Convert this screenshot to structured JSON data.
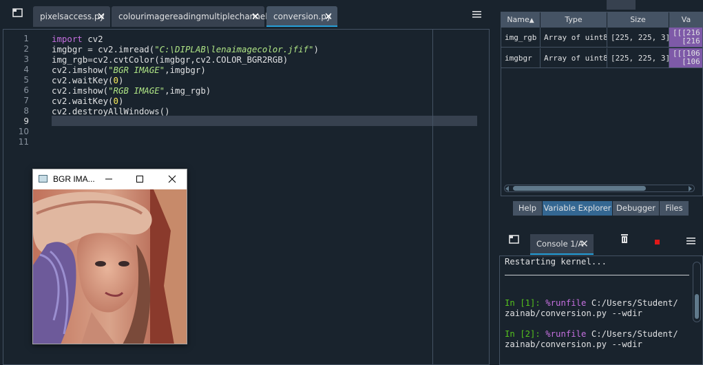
{
  "editor": {
    "tabs": [
      {
        "label": "pixelsaccess.py"
      },
      {
        "label": "colourimagereadingmultiplechannels.py"
      },
      {
        "label": "conversion.py"
      }
    ],
    "close_glyph": "✕",
    "line_numbers": [
      "1",
      "2",
      "3",
      "4",
      "5",
      "6",
      "7",
      "8",
      "9",
      "10",
      "11"
    ],
    "current_line": "9",
    "code": {
      "l1_kw": "import",
      "l1_rest": " cv2",
      "l2_a": "imgbgr = cv2.imread(",
      "l2_str": "\"C:\\DIPLAB\\lenaimagecolor.jfif\"",
      "l2_b": ")",
      "l3": "img_rgb=cv2.cvtColor(imgbgr,cv2.COLOR_BGR2RGB)",
      "l4_a": "cv2.imshow(",
      "l4_str": "\"BGR IMAGE\"",
      "l4_b": ",imgbgr)",
      "l5_a": "cv2.waitKey(",
      "l5_num": "0",
      "l5_b": ")",
      "l6_a": "cv2.imshow(",
      "l6_str": "\"RGB IMAGE\"",
      "l6_b": ",img_rgb)",
      "l7_a": "cv2.waitKey(",
      "l7_num": "0",
      "l7_b": ")",
      "l8": "cv2.destroyAllWindows()"
    }
  },
  "bgr_window": {
    "title": "BGR IMA...",
    "minimize_glyph": "—",
    "maximize_glyph": "☐",
    "close_glyph": "✕"
  },
  "variable_explorer": {
    "columns": [
      "Name",
      "Type",
      "Size",
      "Va"
    ],
    "sort_glyph": "▲",
    "rows": [
      {
        "name": "img_rgb",
        "type": "Array of uint8",
        "size": "[225, 225, 3]",
        "value_l1": "[[[216",
        "value_l2": "  [216"
      },
      {
        "name": "imgbgr",
        "type": "Array of uint8",
        "size": "[225, 225, 3]",
        "value_l1": "[[[106",
        "value_l2": "  [106"
      }
    ],
    "value_color": "#7e5aa8"
  },
  "pane_tabs": [
    {
      "label": "Help"
    },
    {
      "label": "Variable Explorer"
    },
    {
      "label": "Debugger"
    },
    {
      "label": "Files"
    }
  ],
  "console": {
    "tab_label": "Console 1/A",
    "close_glyph": "✕",
    "restart": "Restarting kernel...",
    "in1_prompt": "In [1]:",
    "in1_magic": "%runfile",
    "in1_path1": " C:/Users/Student/",
    "in1_path2": "zainab/conversion.py --wdir",
    "in2_prompt": "In [2]:",
    "in2_magic": "%runfile",
    "in2_path1": " C:/Users/Student/",
    "in2_path2": "zainab/conversion.py --wdir"
  },
  "colors": {
    "background": "#19232d",
    "tab": "#37414f",
    "accent": "#26a0da",
    "keyword": "#c670e0",
    "string": "#b0e686",
    "number": "#faed5c",
    "prompt": "#54c11d",
    "stop": "#e01818"
  }
}
